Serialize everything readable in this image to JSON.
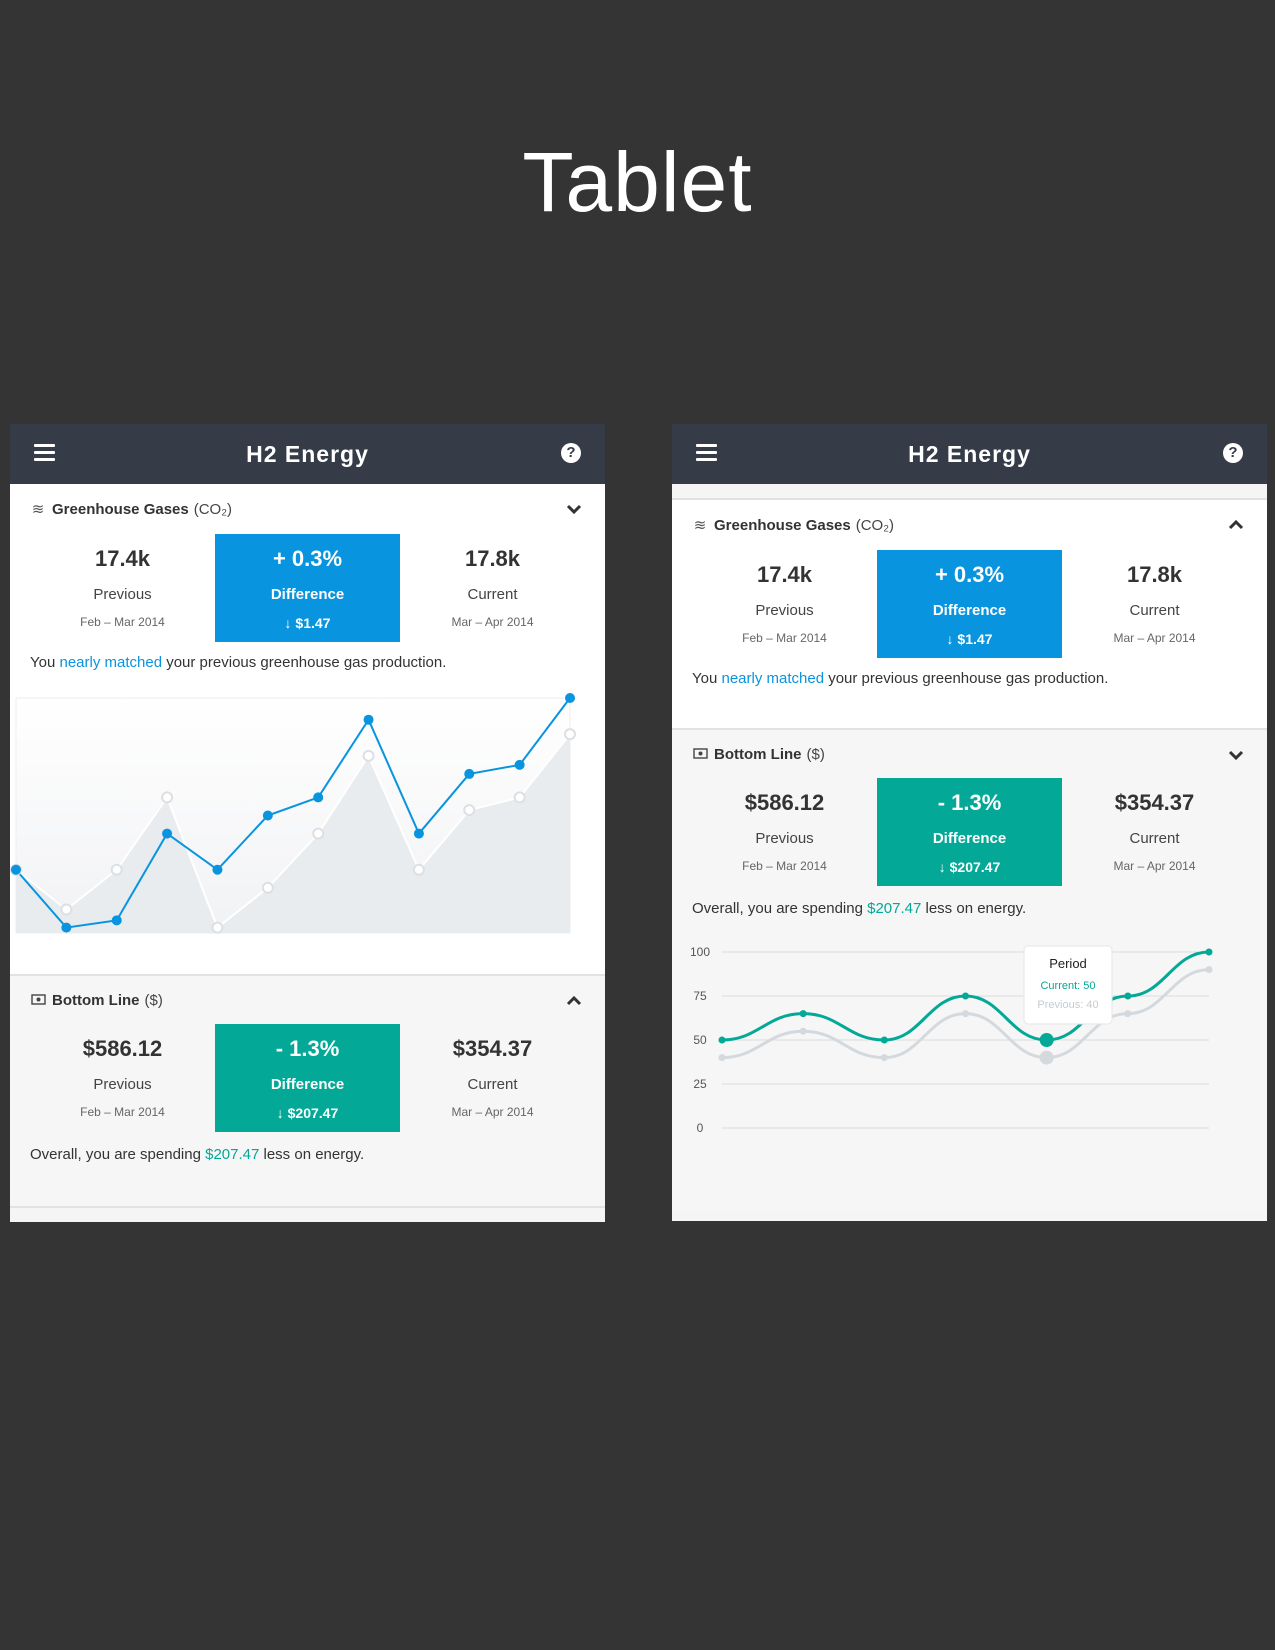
{
  "page": {
    "title": "Tablet"
  },
  "app": {
    "title": "H2 Energy"
  },
  "greenhouse": {
    "title": "Greenhouse Gases",
    "unit": "(CO₂)",
    "previous_value": "17.4k",
    "previous_label": "Previous",
    "previous_period": "Feb – Mar 2014",
    "difference_value": "+ 0.3%",
    "difference_label": "Difference",
    "difference_amount": "↓ $1.47",
    "current_value": "17.8k",
    "current_label": "Current",
    "current_period": "Mar – Apr 2014",
    "summary_pre": "You ",
    "summary_highlight": "nearly matched",
    "summary_post": " your previous greenhouse gas production."
  },
  "bottomline": {
    "title": "Bottom Line",
    "unit": "($)",
    "previous_value": "$586.12",
    "previous_label": "Previous",
    "previous_period": "Feb – Mar 2014",
    "difference_value": "- 1.3%",
    "difference_label": "Difference",
    "difference_amount": "↓ $207.47",
    "current_value": "$354.37",
    "current_label": "Current",
    "current_period": "Mar – Apr 2014",
    "summary_pre": "Overall, you are spending ",
    "summary_highlight": "$207.47",
    "summary_post": " less on energy."
  },
  "tooltip": {
    "title": "Period",
    "current": "Current: 50",
    "previous": "Previous: 40"
  },
  "colors": {
    "blue": "#0994e0",
    "teal": "#04a897",
    "appbar": "#363b48",
    "background": "#343434"
  },
  "chart_data": [
    {
      "type": "line",
      "series": [
        {
          "name": "Current",
          "values": [
            35,
            3,
            7,
            55,
            35,
            65,
            75,
            118,
            55,
            88,
            93,
            130
          ]
        },
        {
          "name": "Previous",
          "values": [
            35,
            13,
            35,
            75,
            3,
            25,
            55,
            98,
            35,
            68,
            75,
            110
          ]
        }
      ],
      "ylim": [
        0,
        130
      ],
      "grid": false
    },
    {
      "type": "line",
      "x": [
        0,
        1,
        2,
        3,
        4,
        5,
        6
      ],
      "series": [
        {
          "name": "Current",
          "values": [
            50,
            65,
            50,
            75,
            50,
            75,
            100
          ]
        },
        {
          "name": "Previous",
          "values": [
            40,
            55,
            40,
            65,
            40,
            65,
            90
          ]
        }
      ],
      "yticks": [
        0,
        25,
        50,
        75,
        100
      ],
      "ylim": [
        0,
        100
      ],
      "grid": true
    }
  ]
}
